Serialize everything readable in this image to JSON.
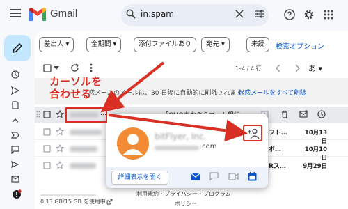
{
  "header": {
    "app_name": "Gmail",
    "search_value": "in:spam"
  },
  "colors": {
    "accent": "#0b57d0",
    "annotation": "#d93025",
    "compose_bg": "#c2e7ff",
    "avatar_bg": "#f28b33"
  },
  "filters": [
    {
      "label": "差出人 ▾"
    },
    {
      "label": "全期間 ▾"
    },
    {
      "label": "添付ファイルあり"
    },
    {
      "label": "宛先 ▾"
    },
    {
      "label": "未読"
    }
  ],
  "search_options_label": "検索オプション",
  "toolbar": {
    "pager": "1–4 / 4 行",
    "language": "あ ▾"
  },
  "banner": {
    "text": "迷惑メールのメールは、30 日後に自動的に削除されます。",
    "link": "迷惑メールをすべて削除"
  },
  "rows": [
    {
      "sender_visible": "…",
      "subject": "「GMOあおぞらネット銀行…",
      "date": ""
    },
    {
      "sender_visible": "",
      "subject": "フト…",
      "date": "10月13日"
    },
    {
      "sender_visible": "",
      "subject": "ポ…",
      "date": "10月10日"
    },
    {
      "sender_visible": "",
      "subject": "Rス…",
      "date": "9月29日"
    }
  ],
  "popup": {
    "name": "bitFlyer, Inc.",
    "email_suffix": ".com",
    "details_button": "詳細表示を開く"
  },
  "annotation": {
    "text": "カーソルを\n合わせる"
  },
  "footer": {
    "storage": "0.13 GB/15 GB を使用中",
    "terms": "利用規約・プライバシー・プログラム",
    "policy": "ポリシー"
  }
}
